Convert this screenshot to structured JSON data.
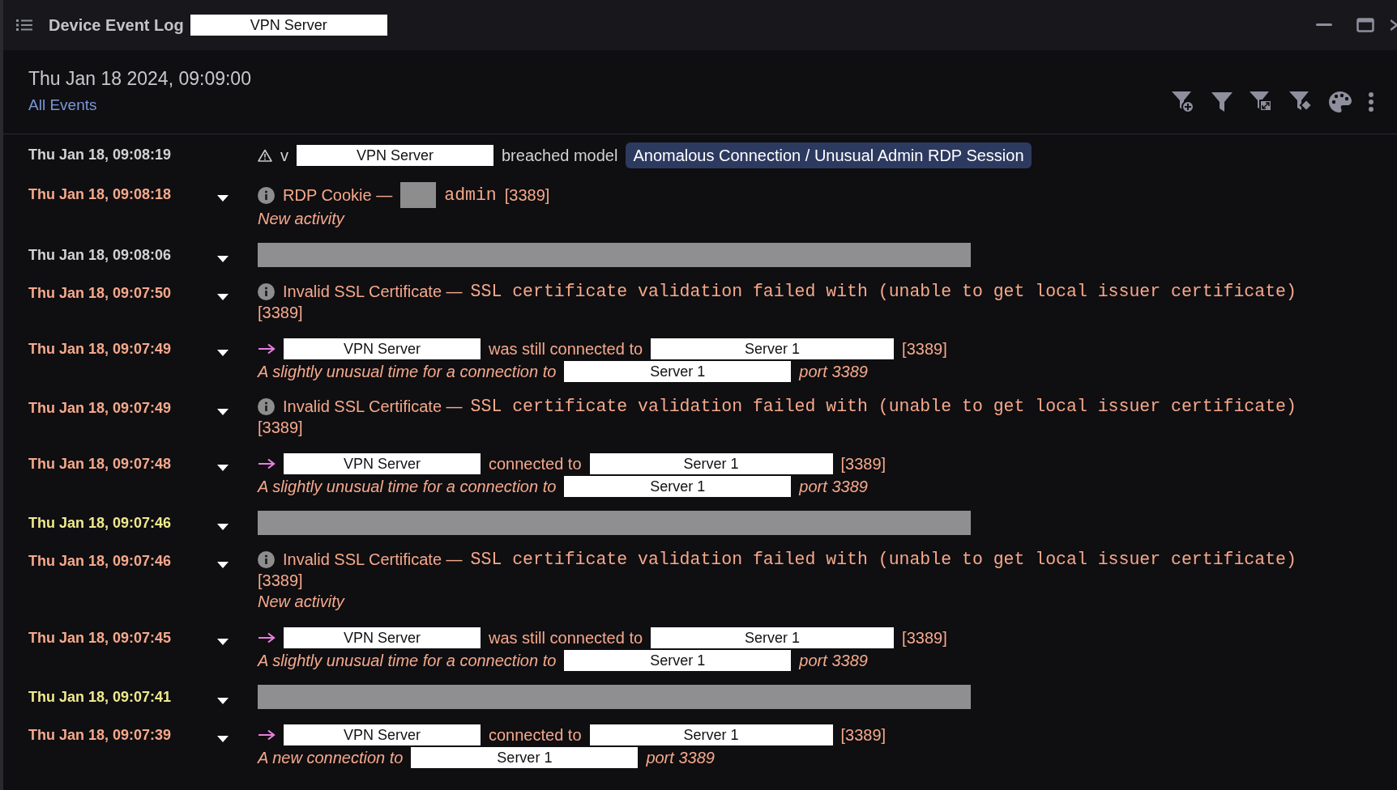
{
  "window": {
    "title": "Device Event Log",
    "title_redaction": "VPN Server"
  },
  "header": {
    "date": "Thu Jan 18 2024, 09:09:00",
    "link": "All Events"
  },
  "events": [
    {
      "time": "Thu Jan 18, 09:08:19",
      "color": "#d2d2d2",
      "expandable": false,
      "line": [
        {
          "kind": "warning"
        },
        {
          "kind": "text",
          "text": "v"
        },
        {
          "kind": "host",
          "text": "VPN Server"
        },
        {
          "kind": "text",
          "text": "breached model"
        },
        {
          "kind": "badge",
          "text": "Anomalous Connection / Unusual Admin RDP Session"
        }
      ]
    },
    {
      "time": "Thu Jan 18, 09:08:18",
      "color": "#f5a98b",
      "expandable": true,
      "line": [
        {
          "kind": "info"
        },
        {
          "kind": "text",
          "text": "RDP Cookie —"
        },
        {
          "kind": "block"
        },
        {
          "kind": "mono",
          "text": "admin"
        },
        {
          "kind": "text",
          "text": "[3389]"
        }
      ],
      "desc": [
        {
          "kind": "text",
          "text": "New activity"
        }
      ]
    },
    {
      "time": "Thu Jan 18, 09:08:06",
      "color": "#d2d2d2",
      "expandable": true,
      "line": [
        {
          "kind": "bar"
        }
      ]
    },
    {
      "time": "Thu Jan 18, 09:07:50",
      "color": "#f5a98b",
      "expandable": true,
      "line": [
        {
          "kind": "info"
        },
        {
          "kind": "text",
          "text": "Invalid SSL Certificate —"
        },
        {
          "kind": "mono",
          "text": "SSL certificate validation failed with (unable to get local issuer certificate)"
        },
        {
          "kind": "text",
          "text": "[3389]"
        }
      ]
    },
    {
      "time": "Thu Jan 18, 09:07:49",
      "color": "#f5a98b",
      "expandable": true,
      "line": [
        {
          "kind": "arrow"
        },
        {
          "kind": "host",
          "text": "VPN Server"
        },
        {
          "kind": "text",
          "text": "was still connected to"
        },
        {
          "kind": "host",
          "text": "Server 1"
        },
        {
          "kind": "text",
          "text": "[3389]"
        }
      ],
      "desc": [
        {
          "kind": "text",
          "text": "A slightly unusual time for a connection to"
        },
        {
          "kind": "host",
          "text": "Server 1"
        },
        {
          "kind": "text",
          "text": "port 3389"
        }
      ]
    },
    {
      "time": "Thu Jan 18, 09:07:49",
      "color": "#f5a98b",
      "expandable": true,
      "line": [
        {
          "kind": "info"
        },
        {
          "kind": "text",
          "text": "Invalid SSL Certificate —"
        },
        {
          "kind": "mono",
          "text": "SSL certificate validation failed with (unable to get local issuer certificate)"
        },
        {
          "kind": "text",
          "text": "[3389]"
        }
      ]
    },
    {
      "time": "Thu Jan 18, 09:07:48",
      "color": "#f5a98b",
      "expandable": true,
      "line": [
        {
          "kind": "arrow"
        },
        {
          "kind": "host",
          "text": "VPN Server"
        },
        {
          "kind": "text",
          "text": "connected to"
        },
        {
          "kind": "host",
          "text": "Server 1"
        },
        {
          "kind": "text",
          "text": "[3389]"
        }
      ],
      "desc": [
        {
          "kind": "text",
          "text": "A slightly unusual time for a connection to"
        },
        {
          "kind": "host",
          "text": "Server 1"
        },
        {
          "kind": "text",
          "text": "port 3389"
        }
      ]
    },
    {
      "time": "Thu Jan 18, 09:07:46",
      "color": "#eeea8e",
      "expandable": true,
      "line": [
        {
          "kind": "bar"
        }
      ]
    },
    {
      "time": "Thu Jan 18, 09:07:46",
      "color": "#f5a98b",
      "expandable": true,
      "line": [
        {
          "kind": "info"
        },
        {
          "kind": "text",
          "text": "Invalid SSL Certificate —"
        },
        {
          "kind": "mono",
          "text": "SSL certificate validation failed with (unable to get local issuer certificate)"
        },
        {
          "kind": "text",
          "text": "[3389]"
        }
      ],
      "desc": [
        {
          "kind": "text",
          "text": "New activity"
        }
      ]
    },
    {
      "time": "Thu Jan 18, 09:07:45",
      "color": "#f5a98b",
      "expandable": true,
      "line": [
        {
          "kind": "arrow"
        },
        {
          "kind": "host",
          "text": "VPN Server"
        },
        {
          "kind": "text",
          "text": "was still connected to"
        },
        {
          "kind": "host",
          "text": "Server 1"
        },
        {
          "kind": "text",
          "text": "[3389]"
        }
      ],
      "desc": [
        {
          "kind": "text",
          "text": "A slightly unusual time for a connection to"
        },
        {
          "kind": "host",
          "text": "Server 1"
        },
        {
          "kind": "text",
          "text": "port 3389"
        }
      ]
    },
    {
      "time": "Thu Jan 18, 09:07:41",
      "color": "#eeea8e",
      "expandable": true,
      "line": [
        {
          "kind": "bar"
        }
      ]
    },
    {
      "time": "Thu Jan 18, 09:07:39",
      "color": "#f5a98b",
      "expandable": true,
      "line": [
        {
          "kind": "arrow"
        },
        {
          "kind": "host",
          "text": "VPN Server"
        },
        {
          "kind": "text",
          "text": "connected to"
        },
        {
          "kind": "host",
          "text": "Server 1"
        },
        {
          "kind": "text",
          "text": "[3389]"
        }
      ],
      "desc": [
        {
          "kind": "text",
          "text": "A new connection to"
        },
        {
          "kind": "host",
          "text": "Server 1"
        },
        {
          "kind": "text",
          "text": "port 3389"
        }
      ]
    }
  ]
}
